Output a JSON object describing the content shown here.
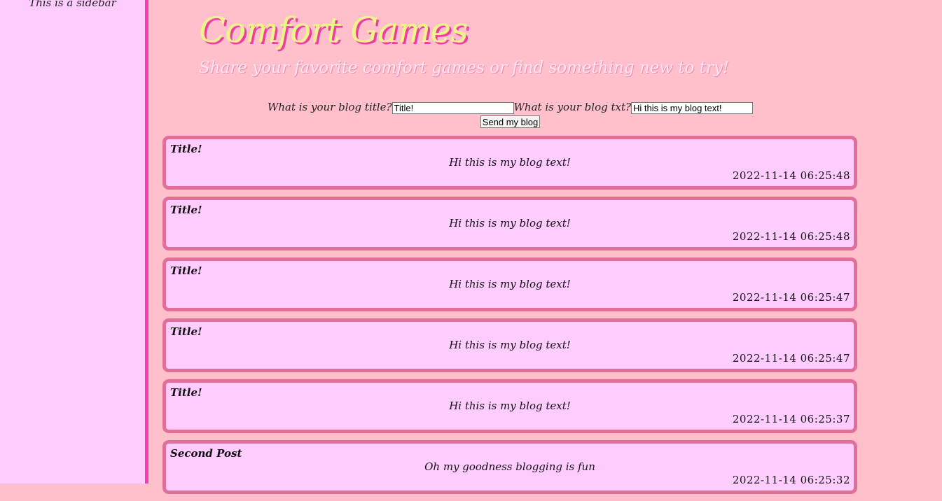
{
  "sidebar": {
    "text": "This is a sidebar"
  },
  "header": {
    "title": "Comfort Games",
    "subtitle": "Share your favorite comfort games or find something new to try!"
  },
  "form": {
    "title_label": "What is your blog title?",
    "title_value": "Title!",
    "text_label": "What is your blog txt?",
    "text_value": "Hi this is my blog text!",
    "send_label": "Send my blog"
  },
  "posts": [
    {
      "title": "Title!",
      "body": "Hi this is my blog text!",
      "date": "2022-11-14 06:25:48"
    },
    {
      "title": "Title!",
      "body": "Hi this is my blog text!",
      "date": "2022-11-14 06:25:48"
    },
    {
      "title": "Title!",
      "body": "Hi this is my blog text!",
      "date": "2022-11-14 06:25:47"
    },
    {
      "title": "Title!",
      "body": "Hi this is my blog text!",
      "date": "2022-11-14 06:25:47"
    },
    {
      "title": "Title!",
      "body": "Hi this is my blog text!",
      "date": "2022-11-14 06:25:37"
    },
    {
      "title": "Second Post",
      "body": "Oh my goodness blogging is fun",
      "date": "2022-11-14 06:25:32"
    }
  ],
  "colors": {
    "background": "#ffc0cb",
    "sidebar_background": "#ffccff",
    "sidebar_border": "#f040b0",
    "title": "#ecf58a",
    "title_shadow": "#f03c9f",
    "post_background": "#ffccff",
    "post_border": "#e07098"
  }
}
